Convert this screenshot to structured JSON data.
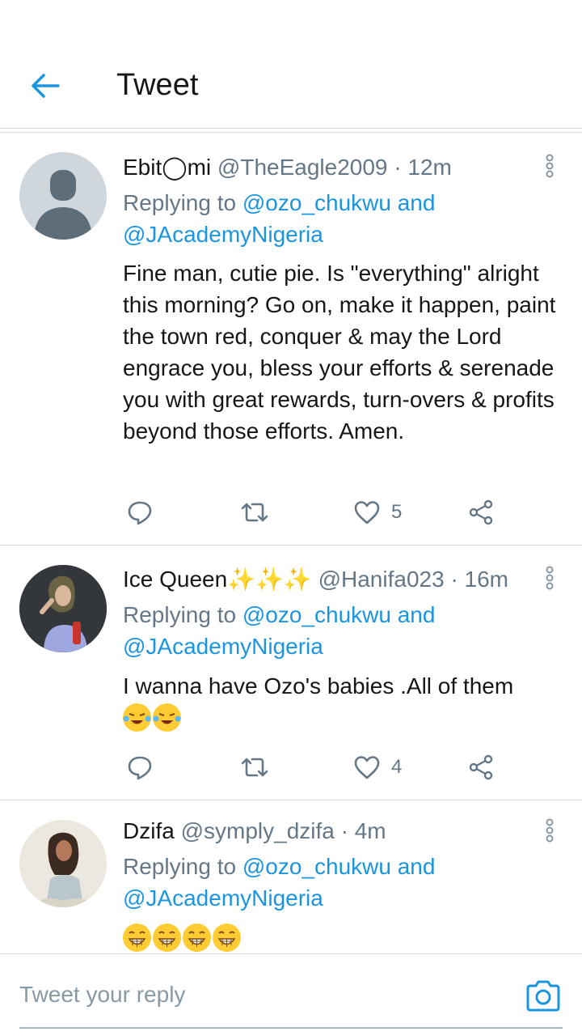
{
  "header": {
    "title": "Tweet"
  },
  "tweets": [
    {
      "name": "Ebit◯mi",
      "handle": "@TheEagle2009",
      "time": "· 12m",
      "replying_prefix": "Replying to ",
      "mention_1": "@ozo_chukwu",
      "mention_joiner": " and",
      "mention_2": "@JAcademyNigeria",
      "text": "Fine man, cutie pie. Is \"everything\" alright this morning? Go on, make it happen, paint the town red, conquer & may the Lord engrace you, bless your efforts & serenade you with great rewards, turn-overs & profits beyond those efforts. Amen.",
      "likes": "5"
    },
    {
      "name": "Ice Queen✨✨✨",
      "handle": "@Hanifa023",
      "time": "· 16m",
      "replying_prefix": "Replying to ",
      "mention_1": "@ozo_chukwu",
      "mention_joiner": " and",
      "mention_2": "@JAcademyNigeria",
      "text": "I wanna have Ozo's babies .All of them",
      "likes": "4"
    },
    {
      "name": "Dzifa",
      "handle": "@symply_dzifa",
      "time": "· 4m",
      "replying_prefix": "Replying to ",
      "mention_1": "@ozo_chukwu",
      "mention_joiner": " and",
      "mention_2": "@JAcademyNigeria"
    }
  ],
  "compose": {
    "placeholder": "Tweet your reply"
  },
  "colors": {
    "accent": "#1b95e0",
    "secondary_text": "#657786",
    "divider": "#d9dde1"
  },
  "icons": [
    "back-arrow-icon",
    "caret-icon",
    "reply-icon",
    "retweet-icon",
    "heart-icon",
    "share-icon",
    "camera-icon",
    "crying-laugh-emoji",
    "laughing-emoji"
  ]
}
